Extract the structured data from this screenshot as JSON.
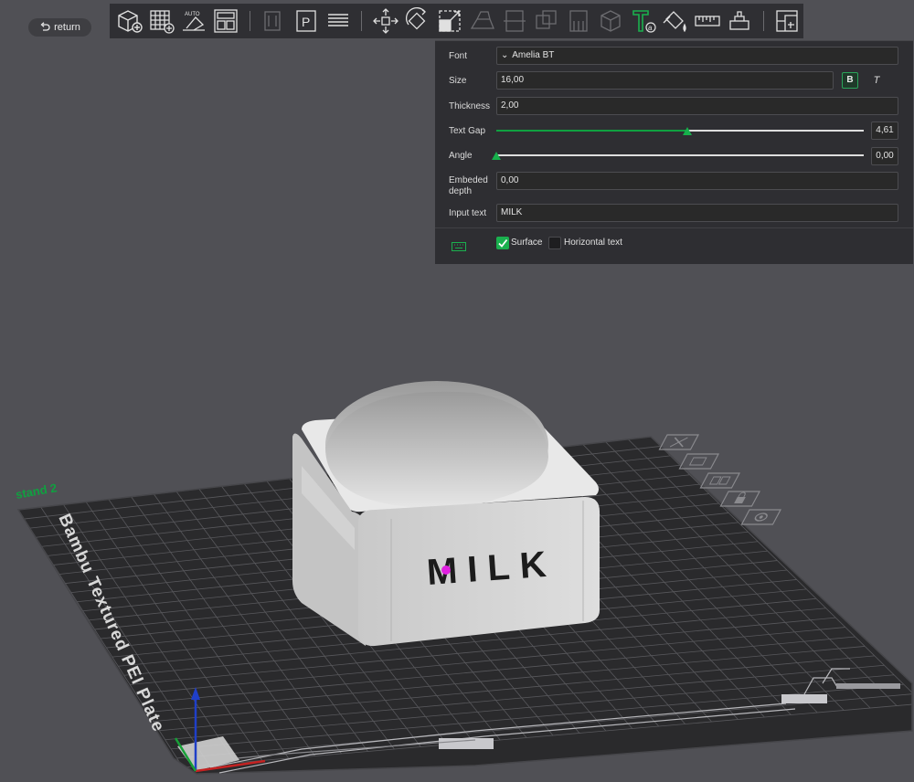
{
  "return_button": {
    "label": "return",
    "icon": "undo-arrow-icon"
  },
  "toolbar": {
    "tools": [
      {
        "name": "add-cube",
        "icon": "cube-plus-icon"
      },
      {
        "name": "add-plate",
        "icon": "grid-plus-icon"
      },
      {
        "name": "auto-orient",
        "icon": "auto-orient-icon"
      },
      {
        "name": "arrange",
        "icon": "arrange-icon"
      },
      {
        "name": "split-objects",
        "icon": "split-icon"
      },
      {
        "name": "split-parts",
        "icon": "p-split-icon"
      },
      {
        "name": "layers",
        "icon": "layers-icon"
      },
      {
        "name": "move",
        "icon": "move-icon"
      },
      {
        "name": "rotate",
        "icon": "rotate-icon"
      },
      {
        "name": "scale",
        "icon": "scale-icon"
      },
      {
        "name": "lay-on-face",
        "icon": "lay-face-icon"
      },
      {
        "name": "cut",
        "icon": "cut-icon"
      },
      {
        "name": "mesh-boolean",
        "icon": "boolean-icon"
      },
      {
        "name": "support-paint",
        "icon": "support-paint-icon"
      },
      {
        "name": "seam-paint",
        "icon": "seam-paint-icon"
      },
      {
        "name": "text",
        "icon": "text-tool-icon",
        "active": true
      },
      {
        "name": "color-paint",
        "icon": "paint-bucket-icon"
      },
      {
        "name": "measure",
        "icon": "ruler-icon"
      },
      {
        "name": "assembly",
        "icon": "assembly-icon"
      },
      {
        "name": "variable-layer",
        "icon": "variable-layer-icon"
      }
    ]
  },
  "panel": {
    "font_label": "Font",
    "font_value": "Amelia BT",
    "size_label": "Size",
    "size_value": "16,00",
    "bold_label": "B",
    "italic_label": "T",
    "thickness_label": "Thickness",
    "thickness_value": "2,00",
    "text_gap_label": "Text Gap",
    "text_gap_value": "4,61",
    "text_gap_fraction": 0.52,
    "angle_label": "Angle",
    "angle_value": "0,00",
    "angle_fraction": 0.0,
    "embeded_label": "Embeded depth",
    "embeded_value": "0,00",
    "input_text_label": "Input text",
    "input_text_value": "MILK",
    "surface_label": "Surface",
    "surface_checked": true,
    "horizontal_label": "Horizontal text",
    "horizontal_checked": false
  },
  "scene": {
    "plate_label": "Bambu Textured PEI Plate",
    "plate_name": "stand 2",
    "embossed_text": "MILK",
    "plate_icons": [
      "close-icon",
      "auto-orient-plate-icon",
      "arrange-plate-icon",
      "lock-icon",
      "settings-icon"
    ],
    "colors": {
      "accent": "#1ab04e",
      "background": "#505055",
      "plate": "#2a2a2c",
      "grid": "#5c5c60",
      "model": "#d9d9d9"
    }
  }
}
